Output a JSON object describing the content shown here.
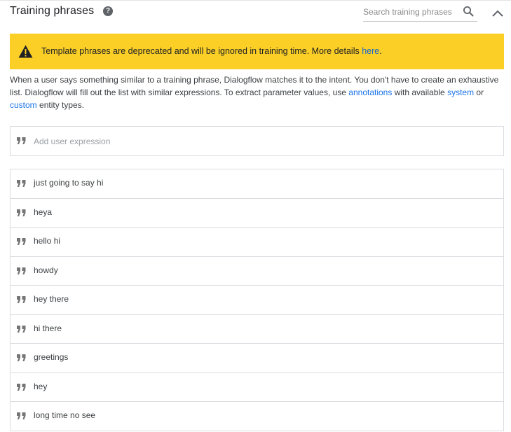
{
  "header": {
    "title": "Training phrases",
    "help_glyph": "?",
    "search_placeholder": "Search training phrases"
  },
  "warning": {
    "text": "Template phrases are deprecated and will be ignored in training time. More details ",
    "link_label": "here",
    "suffix": ".",
    "background": "#fbcf26"
  },
  "description": {
    "part1": "When a user says something similar to a training phrase, Dialogflow matches it to the intent. You don't have to create an exhaustive list. Dialogflow will fill out the list with similar expressions. To extract parameter values, use ",
    "link_annotations": "annotations",
    "part2": " with available ",
    "link_system": "system",
    "part3": " or ",
    "link_custom": "custom",
    "part4": " entity types."
  },
  "add_expression": {
    "placeholder": "Add user expression"
  },
  "phrases": [
    "just going to say hi",
    "heya",
    "hello hi",
    "howdy",
    "hey there",
    "hi there",
    "greetings",
    "hey",
    "long time no see"
  ],
  "icons": {
    "help": "help-circle-icon",
    "search": "search-icon",
    "collapse": "chevron-up-icon",
    "warning": "warning-triangle-icon",
    "quote": "quote-icon"
  },
  "colors": {
    "link": "#1a73e8",
    "border": "#dadce0"
  }
}
